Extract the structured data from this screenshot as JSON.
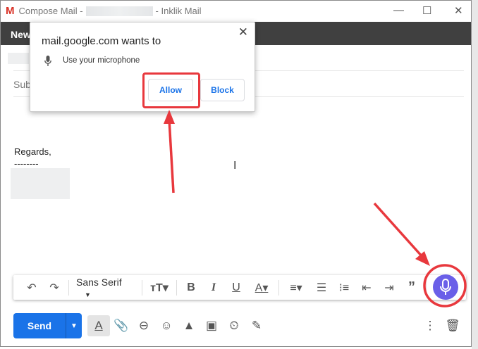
{
  "window": {
    "title_prefix": "Compose Mail -",
    "title_suffix": "- Inklik Mail",
    "minimize": "—",
    "maximize": "☐",
    "close": "✕"
  },
  "compose": {
    "header": "New Message",
    "to_placeholder": "",
    "subject_placeholder": "Subject",
    "body_lines": [
      "Regards,",
      "--------"
    ]
  },
  "dialog": {
    "title": "mail.google.com wants to",
    "permission": "Use your microphone",
    "allow": "Allow",
    "block": "Block",
    "close": "✕"
  },
  "toolbar": {
    "font": "Sans Serif"
  },
  "bottom": {
    "send": "Send"
  },
  "colors": {
    "accent": "#1a73e8",
    "annotation": "#e8383d",
    "mic": "#6a5fe8"
  }
}
